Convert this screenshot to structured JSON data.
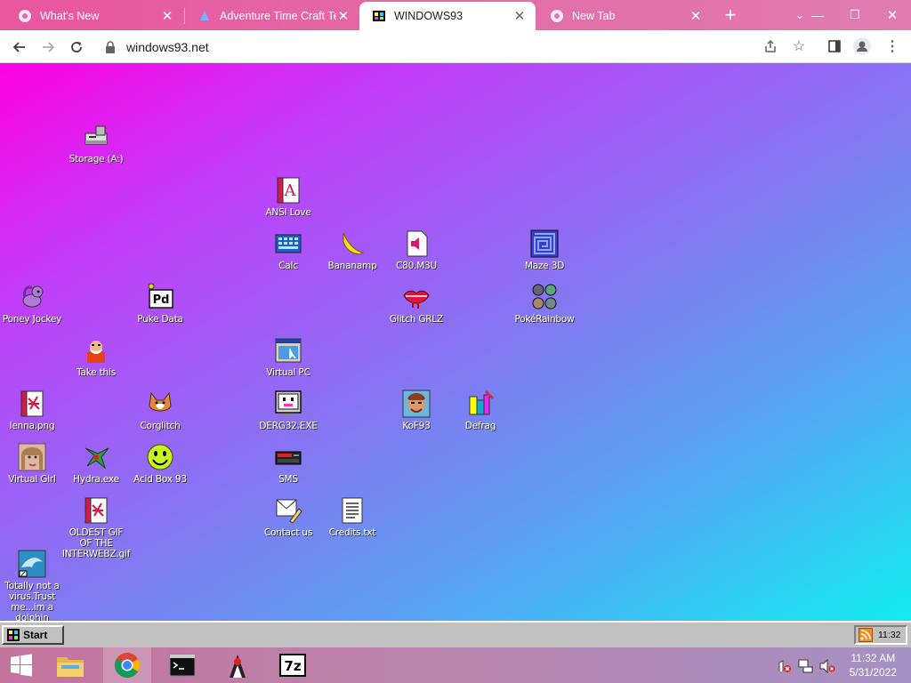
{
  "browser": {
    "tabs": [
      {
        "title": "What's New",
        "active": false
      },
      {
        "title": "Adventure Time Craft Textu",
        "active": false
      },
      {
        "title": "WINDOWS93",
        "active": true
      },
      {
        "title": "New Tab",
        "active": false
      }
    ],
    "url": "windows93.net"
  },
  "desktop": {
    "icons": [
      {
        "label": "Storage (A:)",
        "icon": "floppy-drive-icon"
      },
      {
        "label": "ANSI Love",
        "icon": "ansi-document-icon"
      },
      {
        "label": "Calc",
        "icon": "calculator-icon"
      },
      {
        "label": "Bananamp",
        "icon": "banana-icon"
      },
      {
        "label": "C80.M3U",
        "icon": "audio-file-icon"
      },
      {
        "label": "Maze 3D",
        "icon": "maze-icon"
      },
      {
        "label": "Poney Jockey",
        "icon": "pony-icon"
      },
      {
        "label": "Puke Data",
        "icon": "puredata-icon"
      },
      {
        "label": "Glitch GRLZ",
        "icon": "lips-icon"
      },
      {
        "label": "PokéRainbow",
        "icon": "pokemon-sprites-icon"
      },
      {
        "label": "Take this",
        "icon": "old-man-icon"
      },
      {
        "label": "Virtual PC",
        "icon": "virtual-pc-icon"
      },
      {
        "label": "lenna.png",
        "icon": "image-file-icon"
      },
      {
        "label": "Corglitch",
        "icon": "corgi-icon"
      },
      {
        "label": "DERG32.EXE",
        "icon": "monitor-face-icon"
      },
      {
        "label": "KoF93",
        "icon": "fighter-icon"
      },
      {
        "label": "Defrag",
        "icon": "defrag-icon"
      },
      {
        "label": "Virtual Girl",
        "icon": "girl-face-icon"
      },
      {
        "label": "Hydra.exe",
        "icon": "hydra-icon"
      },
      {
        "label": "Acid Box 93",
        "icon": "smiley-icon"
      },
      {
        "label": "SMS",
        "icon": "sega-console-icon"
      },
      {
        "label": "OLDEST GIF OF THE INTERWEBZ.gif",
        "icon": "gif-file-icon"
      },
      {
        "label": "Contact us",
        "icon": "contact-icon"
      },
      {
        "label": "Credits.txt",
        "icon": "text-file-icon"
      },
      {
        "label": "Totally not a virus.Trust me...im a dolphin",
        "icon": "dolphin-icon"
      }
    ]
  },
  "w93taskbar": {
    "start_label": "Start",
    "clock": "11:32"
  },
  "windows_taskbar": {
    "time": "11:32 AM",
    "date": "5/31/2022",
    "apps": [
      "file-explorer",
      "chrome",
      "terminal",
      "java",
      "7zip"
    ]
  },
  "colors": {
    "desktop_gradient": [
      "#ff00e6",
      "#8c6ff3",
      "#12ecf2"
    ],
    "tab_strip": "#e36aa6"
  }
}
